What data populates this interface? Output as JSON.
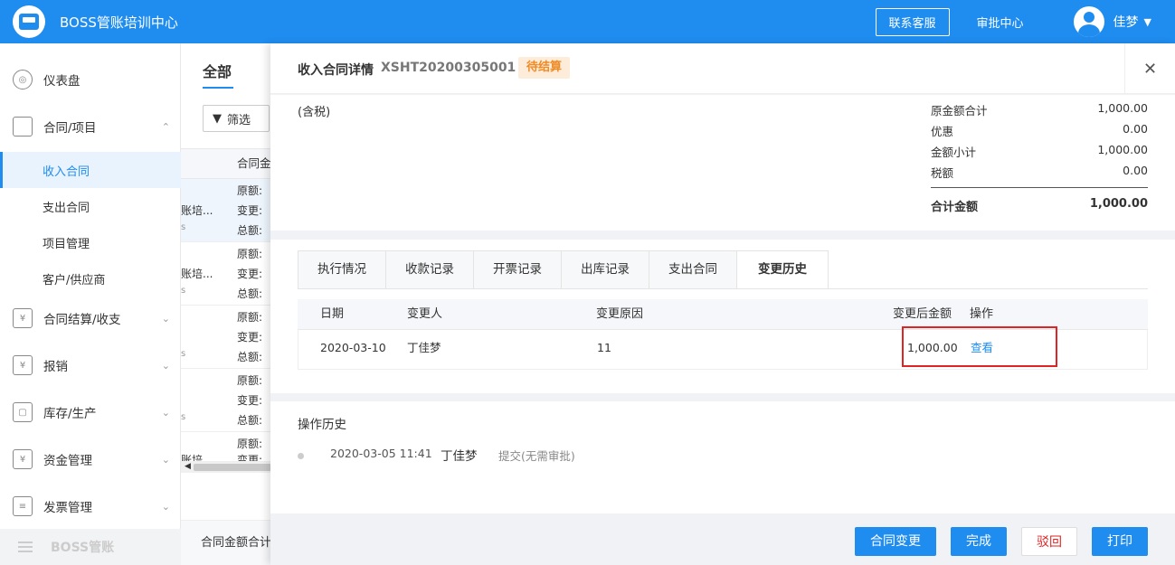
{
  "app": {
    "title": "BOSS管账培训中心"
  },
  "topbar": {
    "contact_label": "联系客服",
    "approve_label": "审批中心",
    "user_name": "佳梦"
  },
  "sidebar": {
    "items": [
      {
        "label": "仪表盘",
        "icon": "dashboard-icon"
      },
      {
        "label": "合同/项目",
        "icon": "folder-icon"
      },
      {
        "label": "收入合同"
      },
      {
        "label": "支出合同"
      },
      {
        "label": "项目管理"
      },
      {
        "label": "客户/供应商"
      },
      {
        "label": "合同结算/收支",
        "icon": "settlement-icon"
      },
      {
        "label": "报销",
        "icon": "reimburse-icon"
      },
      {
        "label": "库存/生产",
        "icon": "box-icon"
      },
      {
        "label": "资金管理",
        "icon": "money-icon"
      },
      {
        "label": "发票管理",
        "icon": "invoice-icon"
      }
    ],
    "footer_label": "BOSS管账"
  },
  "bg_list": {
    "tab": "全部",
    "filter_label": "筛选",
    "column_header": "合同金",
    "row_labels": [
      "原额:",
      "变更:",
      "总额:"
    ],
    "row_names": [
      "账培...",
      "账培...",
      "",
      "",
      "账培"
    ],
    "row_s": "s",
    "footer_label": "合同金额合计"
  },
  "drawer": {
    "title": "收入合同详情",
    "code": "XSHT20200305001",
    "status": "待结算",
    "tax_note": "(含税)",
    "summary": [
      {
        "label": "原金额合计",
        "value": "1,000.00"
      },
      {
        "label": "优惠",
        "value": "0.00"
      },
      {
        "label": "金额小计",
        "value": "1,000.00"
      },
      {
        "label": "税额",
        "value": "0.00"
      }
    ],
    "total": {
      "label": "合计金额",
      "value": "1,000.00"
    },
    "tabs": [
      "执行情况",
      "收款记录",
      "开票记录",
      "出库记录",
      "支出合同",
      "变更历史"
    ],
    "active_tab": "变更历史",
    "table": {
      "headers": [
        "日期",
        "变更人",
        "变更原因",
        "变更后金额",
        "操作"
      ],
      "rows": [
        {
          "date": "2020-03-10",
          "user": "丁佳梦",
          "reason": "11",
          "amount": "1,000.00",
          "action": "查看"
        }
      ]
    },
    "history": {
      "title": "操作历史",
      "entries": [
        {
          "time": "2020-03-05 11:41",
          "user": "丁佳梦",
          "action": "提交(无需审批)"
        }
      ]
    },
    "buttons": {
      "change": "合同变更",
      "done": "完成",
      "reject": "驳回",
      "print": "打印"
    }
  },
  "colors": {
    "primary": "#1f8cf0",
    "danger": "#e02424",
    "badge_bg": "#fdecd9",
    "badge_text": "#f08a24"
  }
}
